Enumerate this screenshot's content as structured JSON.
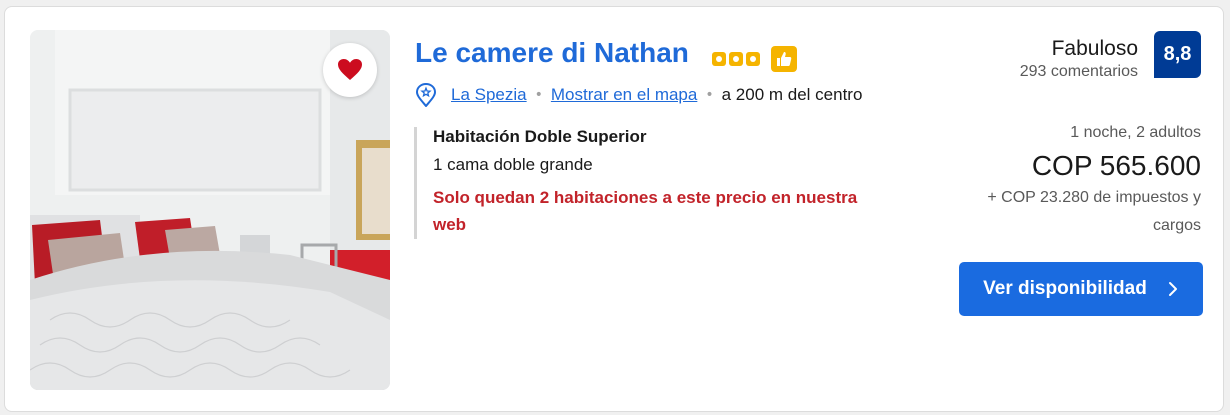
{
  "listing": {
    "name": "Le camere di Nathan",
    "star_icons": [
      "rating-square-icon",
      "rating-square-icon",
      "rating-square-icon"
    ],
    "preferred_icon": "thumbs-up-icon",
    "favorite_icon": "heart-icon",
    "city": "La Spezia",
    "map_link": "Mostrar en el mapa",
    "distance": "a 200 m del centro"
  },
  "room": {
    "type": "Habitación Doble Superior",
    "bed": "1 cama doble grande",
    "urgency": "Solo quedan 2 habitaciones a este precio en nuestra web"
  },
  "review": {
    "label": "Fabuloso",
    "count": "293 comentarios",
    "score": "8,8"
  },
  "pricing": {
    "occupancy": "1 noche, 2 adultos",
    "price": "COP 565.600",
    "taxes": "+ COP 23.280 de impuestos y cargos"
  },
  "cta": {
    "label": "Ver disponibilidad",
    "icon": "chevron-right-icon"
  },
  "colors": {
    "link_blue": "#1f6ad8",
    "score_bg": "#003b95",
    "cta_bg": "#1a6be0",
    "urgent_red": "#c2232a",
    "star_yellow": "#f5b400",
    "heart_red": "#cc0c1f"
  }
}
